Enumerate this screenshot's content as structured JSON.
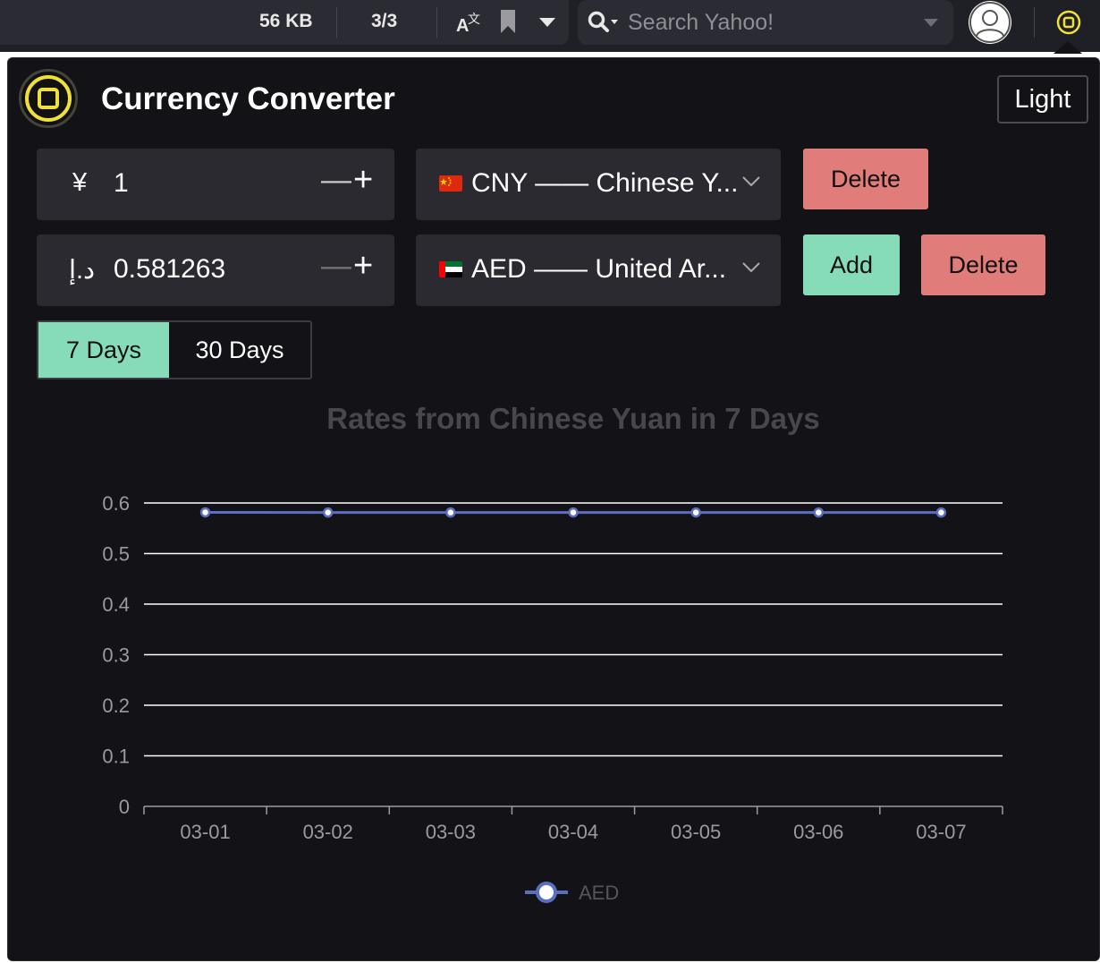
{
  "browser": {
    "file_size": "56 KB",
    "match_count": "3/3",
    "search_placeholder": "Search Yahoo!"
  },
  "app": {
    "title": "Currency Converter",
    "theme_button": "Light"
  },
  "rows": [
    {
      "symbol": "¥",
      "amount": "1",
      "currency_label": "CNY —— Chinese Y...",
      "flag": "china-flag"
    },
    {
      "symbol": "د.إ",
      "amount": "0.581263",
      "currency_label": "AED —— United Ar...",
      "flag": "uae-flag"
    }
  ],
  "buttons": {
    "delete": "Delete",
    "add": "Add"
  },
  "range_tabs": {
    "seven": "7 Days",
    "thirty": "30 Days",
    "selected": "7 Days"
  },
  "colors": {
    "accent": "#86dcb9",
    "danger": "#e07c7a",
    "line": "#5b6fc0",
    "background": "#121217"
  },
  "chart_data": {
    "type": "line",
    "title": "Rates from Chinese Yuan in 7 Days",
    "categories": [
      "03-01",
      "03-02",
      "03-03",
      "03-04",
      "03-05",
      "03-06",
      "03-07"
    ],
    "series": [
      {
        "name": "AED",
        "values": [
          0.5815,
          0.5812,
          0.5812,
          0.5813,
          0.5813,
          0.5813,
          0.5812
        ]
      }
    ],
    "ylim": [
      0,
      0.6
    ],
    "yticks": [
      "0",
      "0.1",
      "0.2",
      "0.3",
      "0.4",
      "0.5",
      "0.6"
    ],
    "grid": true,
    "legend": "bottom"
  }
}
